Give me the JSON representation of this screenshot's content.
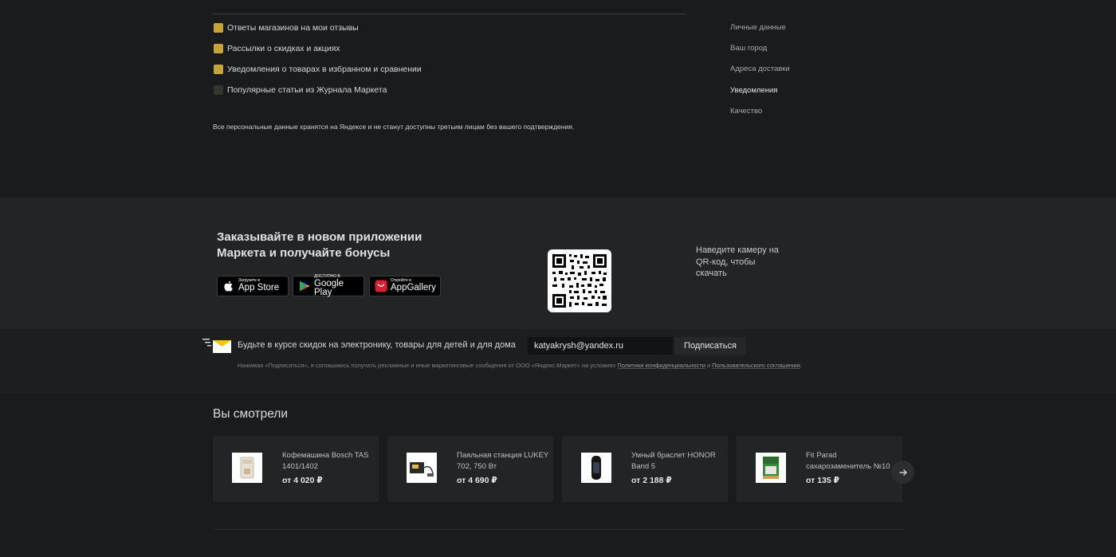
{
  "notifications": {
    "items": [
      {
        "label": "Ответы магазинов на мои отзывы",
        "checked": true
      },
      {
        "label": "Рассылки о скидках и акциях",
        "checked": true
      },
      {
        "label": "Уведомления о товарах в избранном и сравнении",
        "checked": true
      },
      {
        "label": "Популярные статьи из Журнала Маркета",
        "checked": false
      }
    ],
    "privacy_note": "Все персональные данные хранятся на Яндексе и не станут доступны третьим лицам без вашего подтверждения."
  },
  "side_nav": {
    "items": [
      {
        "label": "Личные данные",
        "active": false
      },
      {
        "label": "Ваш город",
        "active": false
      },
      {
        "label": "Адреса доставки",
        "active": false
      },
      {
        "label": "Уведомления",
        "active": true
      },
      {
        "label": "Качество",
        "active": false
      }
    ]
  },
  "app_promo": {
    "heading": "Заказывайте в новом приложении Маркета и получайте бонусы",
    "qr_hint": "Наведите камеру на QR-код, чтобы скачать",
    "stores": [
      {
        "small": "Загрузите в",
        "big": "App Store",
        "icon": "apple-icon"
      },
      {
        "small": "ДОСТУПНО В",
        "big": "Google Play",
        "icon": "google-play-icon"
      },
      {
        "small": "Откройте в",
        "big": "AppGallery",
        "icon": "huawei-icon"
      }
    ]
  },
  "subscribe": {
    "text": "Будьте в курсе скидок на электронику, товары для детей и для дома",
    "email_value": "katyakrysh@yandex.ru",
    "button_label": "Подписаться",
    "legal_prefix": "Нажимая «Подписаться», я соглашаюсь получать рекламные и иные маркетинговые сообщения от ООО «Яндекс.Маркет» на условиях ",
    "legal_link1": "Политики конфиденциальности",
    "legal_mid": " и ",
    "legal_link2": "Пользовательского соглашения",
    "legal_suffix": "."
  },
  "viewed": {
    "title": "Вы смотрели",
    "products": [
      {
        "name": "Кофемашина Bosch TAS 1401/1402",
        "price": "от 4 020 ₽",
        "icon": "coffee-machine-icon"
      },
      {
        "name": "Паяльная станция LUKEY 702, 750 Вт",
        "price": "от 4 690 ₽",
        "icon": "soldering-station-icon"
      },
      {
        "name": "Умный браслет HONOR Band 5",
        "price": "от 2 188 ₽",
        "icon": "fitness-band-icon"
      },
      {
        "name": "Fit Parad сахарозаменитель №10",
        "price": "от 135 ₽",
        "icon": "sweetener-icon"
      }
    ]
  },
  "colors": {
    "accent_checkbox": "#c6a43a",
    "background": "#191b1c",
    "panel": "#222425"
  }
}
